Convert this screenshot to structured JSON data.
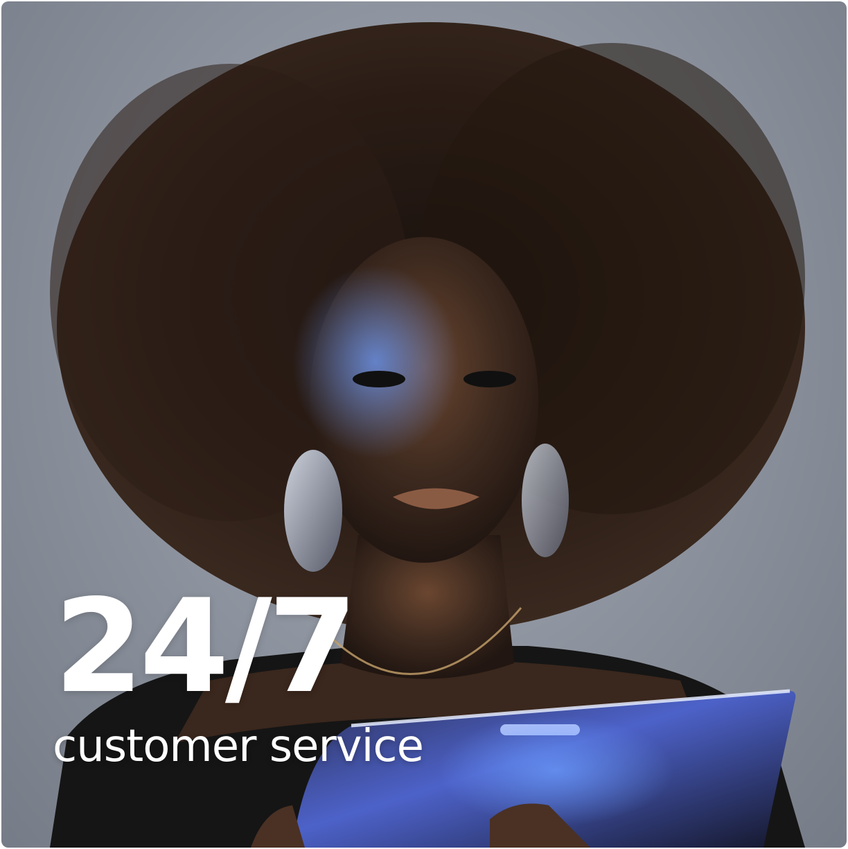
{
  "hero": {
    "headline": "24/7",
    "subheadline": "customer service",
    "text_color": "#ffffff"
  }
}
